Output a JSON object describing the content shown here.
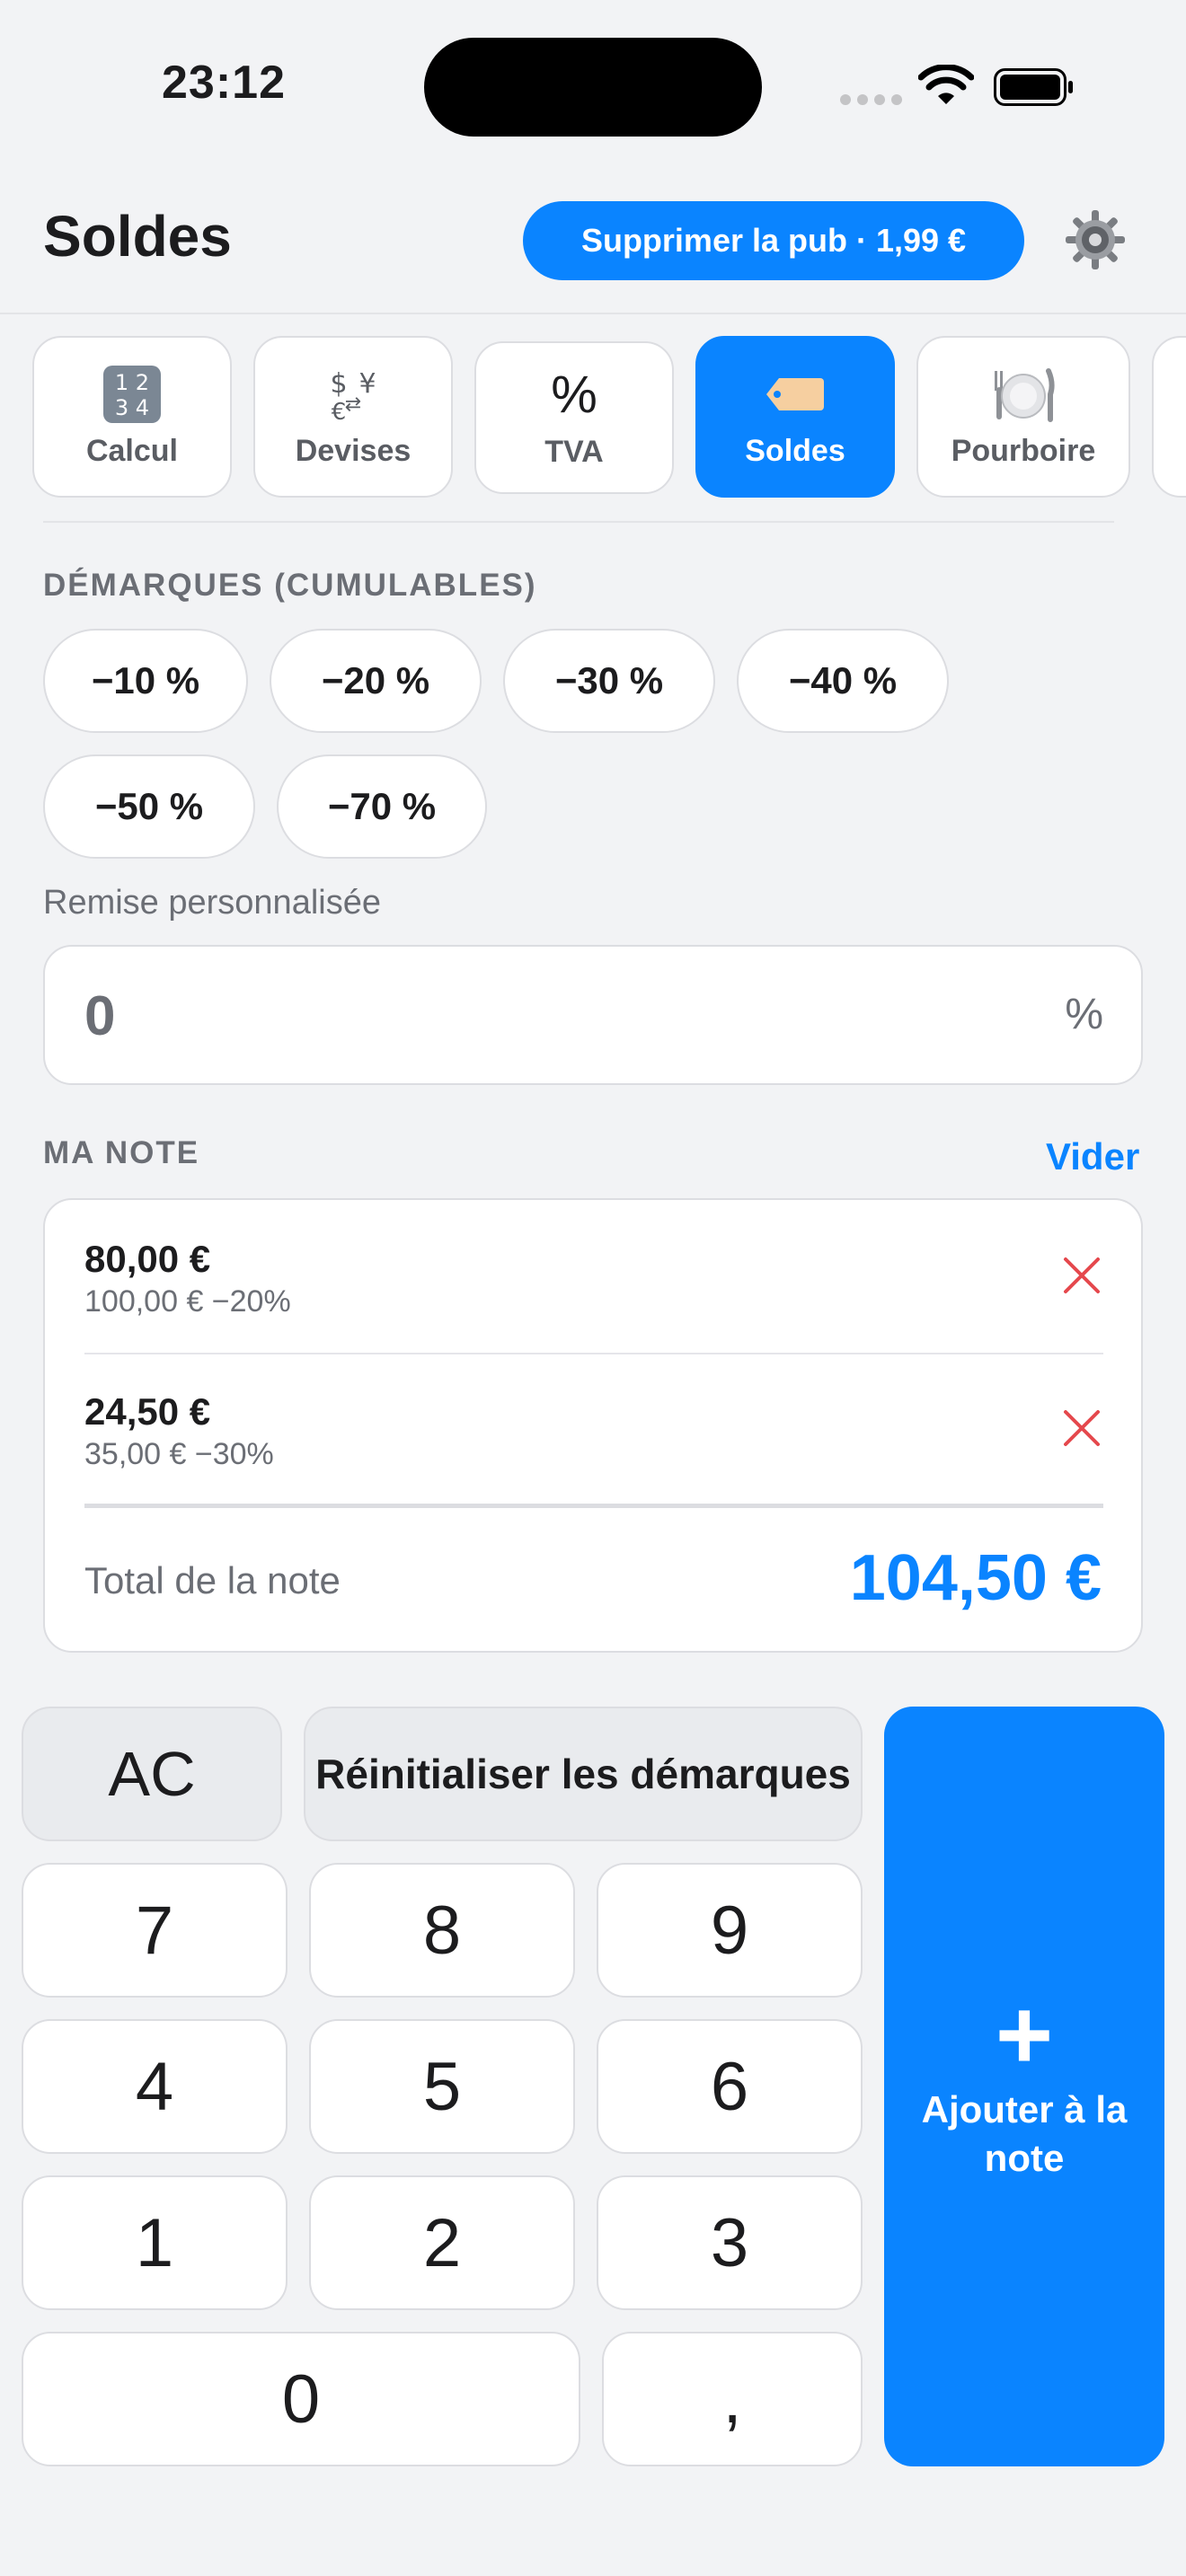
{
  "status_bar": {
    "time": "23:12"
  },
  "header": {
    "title": "Soldes",
    "promo_label": "Supprimer la pub · 1,99 €"
  },
  "tabs": [
    {
      "label": "Calcul",
      "icon": "calculator-icon"
    },
    {
      "label": "Devises",
      "icon": "currency-exchange-icon"
    },
    {
      "label": "TVA",
      "icon": "percent-icon"
    },
    {
      "label": "Soldes",
      "icon": "price-tag-icon",
      "active": true
    },
    {
      "label": "Pourboire",
      "icon": "plate-cutlery-icon"
    }
  ],
  "discounts": {
    "label": "DÉMARQUES (CUMULABLES)",
    "chips": [
      "−10 %",
      "−20 %",
      "−30 %",
      "−40 %",
      "−50 %",
      "−70 %"
    ]
  },
  "custom_discount": {
    "label": "Remise personnalisée",
    "value": "0",
    "unit": "%"
  },
  "note": {
    "label": "MA NOTE",
    "clear_label": "Vider",
    "items": [
      {
        "price": "80,00 €",
        "detail": "100,00 € −20%"
      },
      {
        "price": "24,50 €",
        "detail": "35,00 € −30%"
      }
    ],
    "total_label": "Total de la note",
    "total_value": "104,50 €"
  },
  "keypad": {
    "ac": "AC",
    "reset": "Réinitialiser les démarques",
    "digits": [
      "7",
      "8",
      "9",
      "4",
      "5",
      "6",
      "1",
      "2",
      "3",
      "0",
      ","
    ],
    "add_symbol": "+",
    "add_label": "Ajouter à la note"
  },
  "colors": {
    "accent": "#0a84ff",
    "delete": "#e5484d",
    "background": "#f2f3f5"
  }
}
